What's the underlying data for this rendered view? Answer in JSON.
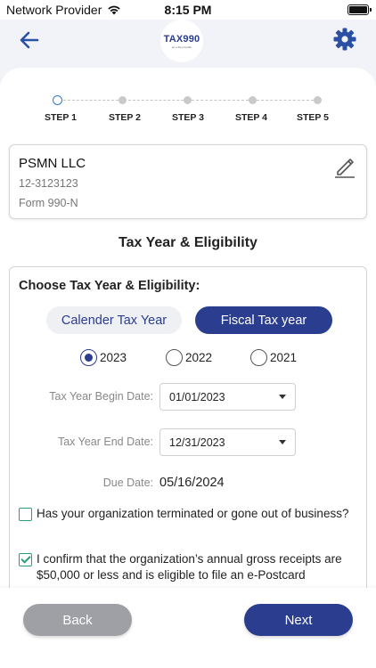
{
  "status_bar": {
    "carrier": "Network Provider",
    "time": "8:15 PM"
  },
  "header": {
    "logo_text": "TAX990",
    "logo_subtext": "an e-file provider"
  },
  "stepper": {
    "steps": [
      {
        "label": "STEP 1",
        "active": true
      },
      {
        "label": "STEP 2",
        "active": false
      },
      {
        "label": "STEP 3",
        "active": false
      },
      {
        "label": "STEP 4",
        "active": false
      },
      {
        "label": "STEP 5",
        "active": false
      }
    ]
  },
  "organization": {
    "name": "PSMN LLC",
    "ein": "12-3123123",
    "form": "Form 990-N"
  },
  "section_title": "Tax Year & Eligibility",
  "eligibility": {
    "heading": "Choose Tax Year & Eligibility:",
    "tabs": {
      "calendar": "Calender Tax Year",
      "fiscal": "Fiscal Tax year",
      "selected": "fiscal"
    },
    "years": [
      {
        "label": "2023",
        "selected": true
      },
      {
        "label": "2022",
        "selected": false
      },
      {
        "label": "2021",
        "selected": false
      }
    ],
    "begin_date": {
      "label": "Tax Year Begin Date:",
      "value": "01/01/2023"
    },
    "end_date": {
      "label": "Tax Year End Date:",
      "value": "12/31/2023"
    },
    "due_date": {
      "label": "Due Date:",
      "value": "05/16/2024"
    },
    "terminated": {
      "text": "Has your organization terminated or gone out of business?",
      "checked": false
    },
    "confirm": {
      "text": "I confirm that the organization’s annual gross receipts are $50,000 or less and is eligible to file an e-Postcard",
      "checked": true
    }
  },
  "footer": {
    "back_label": "Back",
    "next_label": "Next"
  },
  "colors": {
    "primary": "#2b3d8f",
    "accent_blue": "#2b78c6",
    "checkbox_green": "#2a9d7a",
    "back_button": "#9ea0a6",
    "header_bg": "#f1f3f8"
  }
}
